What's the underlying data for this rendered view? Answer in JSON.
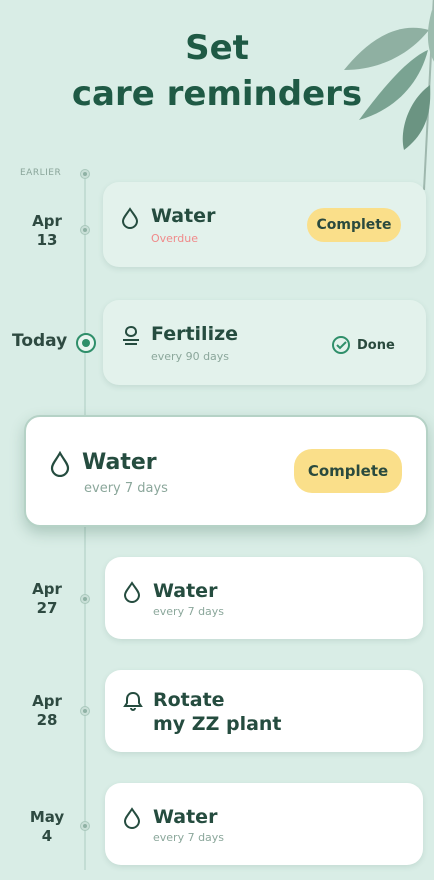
{
  "header": {
    "title_line1": "Set",
    "title_line2": "care reminders"
  },
  "timeline": {
    "earlier_label": "EARLIER",
    "today_label": "Today",
    "dates": [
      {
        "month": "Apr",
        "day": "13"
      },
      {
        "month": "Apr",
        "day": "27"
      },
      {
        "month": "Apr",
        "day": "28"
      },
      {
        "month": "May",
        "day": "4"
      }
    ]
  },
  "reminders": [
    {
      "title": "Water",
      "subtitle": "Overdue",
      "action": "Complete",
      "icon": "water-drop-icon"
    },
    {
      "title": "Fertilize",
      "subtitle": "every 90 days",
      "action": "Done",
      "icon": "fertilizer-icon"
    },
    {
      "title": "Water",
      "subtitle": "every 7 days",
      "action": "Complete",
      "icon": "water-drop-icon"
    },
    {
      "title": "Water",
      "subtitle": "every 7 days",
      "icon": "water-drop-icon"
    },
    {
      "title_line1": "Rotate",
      "title_line2": "my ZZ plant",
      "icon": "bell-icon"
    },
    {
      "title": "Water",
      "subtitle": "every 7 days",
      "icon": "water-drop-icon"
    }
  ],
  "colors": {
    "background": "#d9ede6",
    "accent": "#2f8f6a",
    "button": "#fadf8a",
    "overdue": "#f08a8a"
  }
}
